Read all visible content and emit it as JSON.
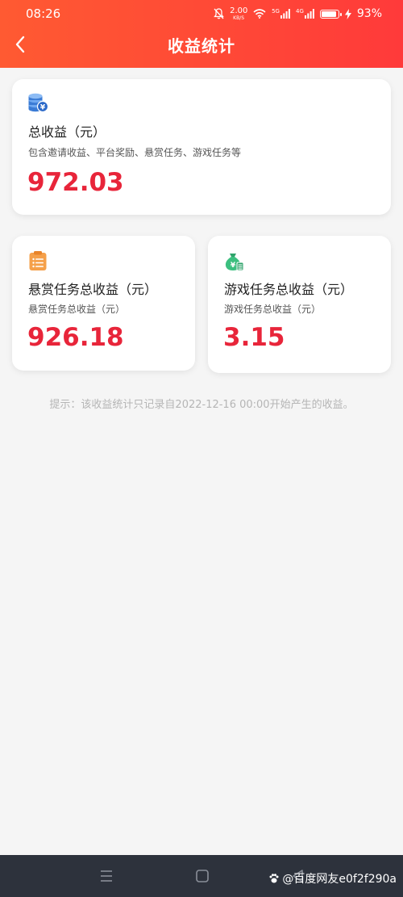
{
  "status_bar": {
    "time": "08:26",
    "net_speed_value": "2.00",
    "net_speed_unit": "KB/S",
    "sim1_label": "5G",
    "sim2_label": "4G",
    "battery": "93%",
    "battery_level": 0.93
  },
  "header": {
    "title": "收益统计"
  },
  "total_card": {
    "title": "总收益（元）",
    "subtitle": "包含邀请收益、平台奖励、悬赏任务、游戏任务等",
    "value": "972.03",
    "icon": "coins-yen-icon"
  },
  "reward_card": {
    "title": "悬赏任务总收益（元）",
    "subtitle": "悬赏任务总收益（元）",
    "value": "926.18",
    "icon": "clipboard-list-icon"
  },
  "game_card": {
    "title": "游戏任务总收益（元）",
    "subtitle": "游戏任务总收益（元）",
    "value": "3.15",
    "icon": "money-bag-icon"
  },
  "tip": "提示：该收益统计只记录自2022-12-16 00:00开始产生的收益。",
  "watermark": "@百度网友e0f2f290a",
  "colors": {
    "header_start": "#ff5a32",
    "header_end": "#ff3a3a",
    "value_red": "#e8253a",
    "nav_bg": "#2d323c"
  }
}
